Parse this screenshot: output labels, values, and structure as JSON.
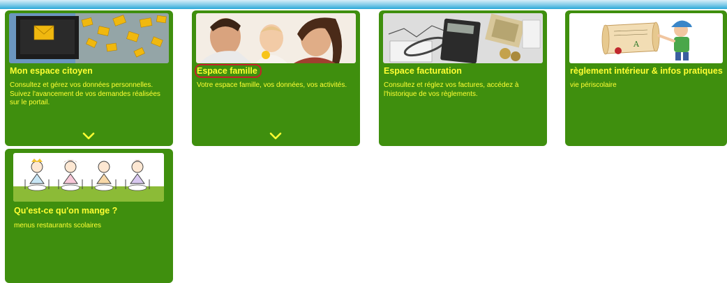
{
  "cards": [
    {
      "title": "Mon espace citoyen",
      "description": "Consultez et gérez vos données personnelles. Suivez l'avancement de vos demandes réalisées sur le portail.",
      "image": "envelopes-laptop-image",
      "expand_icon": "chevron-down-icon"
    },
    {
      "title": "Espace famille",
      "description": "Votre espace famille, vos données, vos activités.",
      "image": "family-photo-image",
      "expand_icon": "chevron-down-icon",
      "highlighted": true
    },
    {
      "title": "Espace facturation",
      "description": "Consultez et réglez vos factures, accédez à l'historique de vos règlements.",
      "image": "billing-calculator-image"
    },
    {
      "title": "règlement intérieur & infos pratiques",
      "description": "vie périscolaire",
      "image": "scroll-rules-image"
    },
    {
      "title": "Qu'est-ce qu'on mange ?",
      "description": "menus restaurants scolaires",
      "image": "children-at-table-image"
    }
  ],
  "colors": {
    "card_background": "#3f8f0e",
    "card_text": "#ffff33",
    "highlight_ring": "#c8202a",
    "header_band": "#2aa8d8"
  }
}
